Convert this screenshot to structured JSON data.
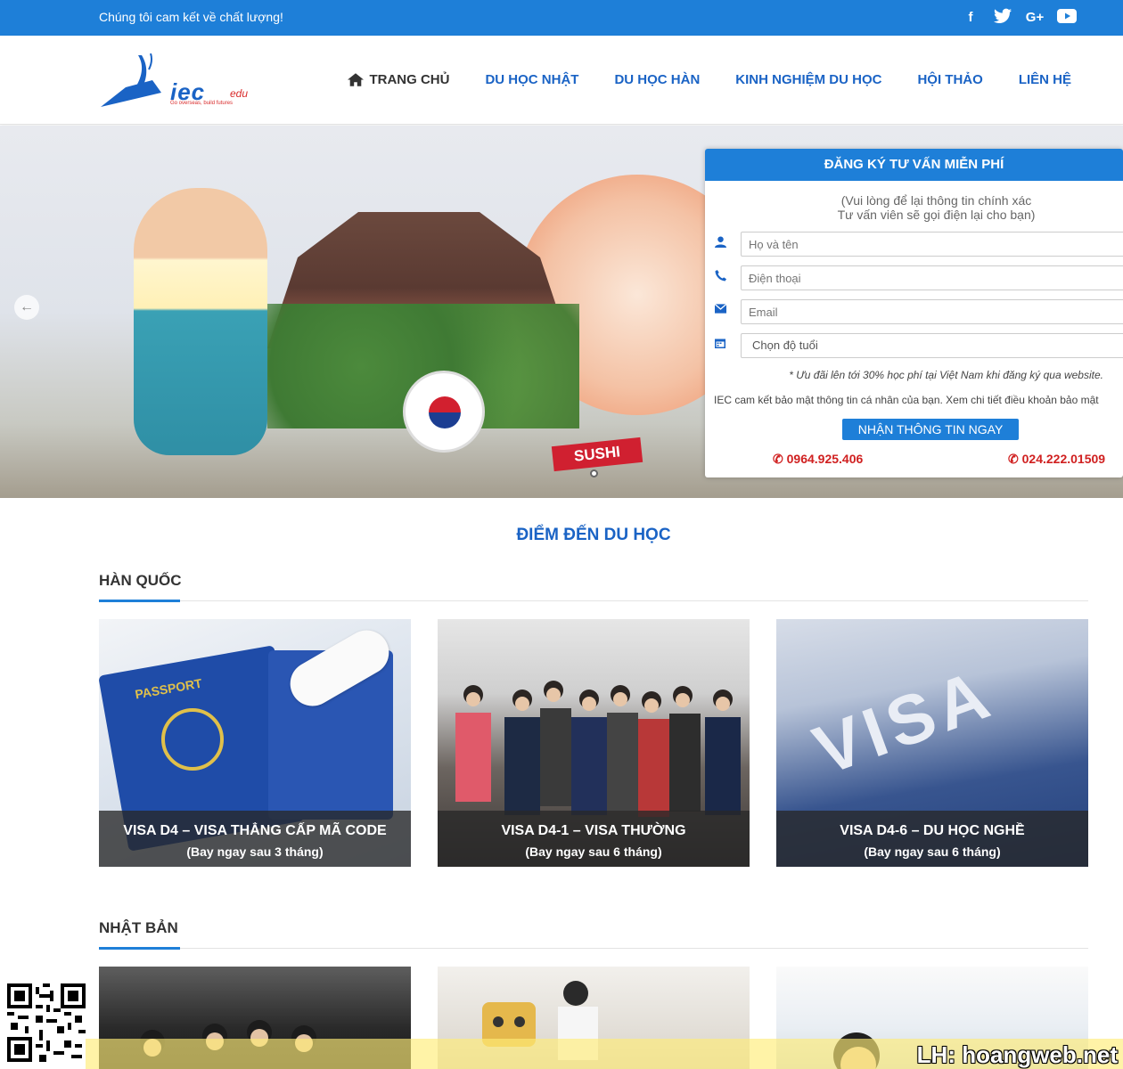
{
  "topbar": {
    "slogan": "Chúng tôi cam kết về chất lượng!",
    "social": [
      {
        "icon": "facebook-icon",
        "glyph": "f"
      },
      {
        "icon": "twitter-icon",
        "glyph": "🐦"
      },
      {
        "icon": "google-plus-icon",
        "glyph": "G+"
      },
      {
        "icon": "youtube-icon",
        "glyph": "▶"
      }
    ]
  },
  "logo": {
    "wordmark": "iec",
    "suffix": "edu",
    "tagline": "Go overseas, build futures"
  },
  "nav": [
    {
      "label": "TRANG CHỦ",
      "active": true
    },
    {
      "label": "DU HỌC NHẬT"
    },
    {
      "label": "DU HỌC HÀN"
    },
    {
      "label": "KINH NGHIỆM DU HỌC"
    },
    {
      "label": "HỘI THẢO"
    },
    {
      "label": "LIÊN HỆ"
    }
  ],
  "hero": {
    "sushi_label": "SUSHI"
  },
  "form": {
    "title": "ĐĂNG KÝ TƯ VẤN MIỄN PHÍ",
    "note_line1": "(Vui lòng để lại thông tin chính xác",
    "note_line2": "Tư vấn viên sẽ gọi điện lại cho bạn)",
    "name_placeholder": "Họ và tên",
    "phone_placeholder": "Điện thoại",
    "email_placeholder": "Email",
    "age_select": "Chọn độ tuổi",
    "offer": "* Ưu đãi lên tới 30% học phí tại Việt Nam khi đăng ký qua website.",
    "privacy": "IEC cam kết bảo mật thông tin cá nhân của bạn. Xem chi tiết điều khoản bảo mật",
    "submit": "NHẬN THÔNG TIN NGAY",
    "phone1": "0964.925.406",
    "phone2": "024.222.01509"
  },
  "section": {
    "title": "ĐIỂM ĐẾN DU HỌC"
  },
  "categories": [
    {
      "name": "HÀN QUỐC",
      "cards": [
        {
          "title": "VISA D4 – VISA THẲNG CẤP MÃ CODE",
          "subtitle": "(Bay ngay sau 3 tháng)"
        },
        {
          "title": "VISA D4-1 – VISA THƯỜNG",
          "subtitle": "(Bay ngay sau 6 tháng)"
        },
        {
          "title": "VISA D4-6 – DU HỌC NGHỀ",
          "subtitle": "(Bay ngay sau 6 tháng)"
        }
      ]
    },
    {
      "name": "NHẬT BẢN"
    }
  ],
  "img1": {
    "passport_label": "PASSPORT"
  },
  "img3": {
    "visa_label": "VISA"
  },
  "banner": {
    "text": "LH: hoangweb.net"
  }
}
